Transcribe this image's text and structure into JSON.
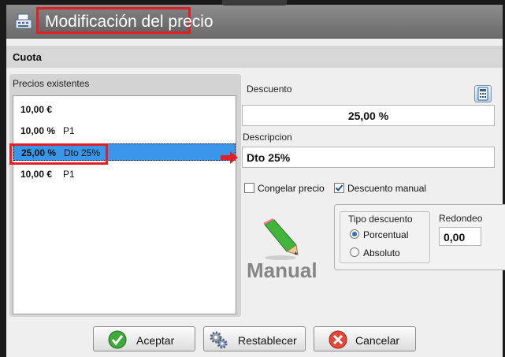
{
  "window": {
    "title": "Modificación del precio"
  },
  "section": {
    "title": "Cuota"
  },
  "prices": {
    "label": "Precios existentes",
    "items": [
      {
        "value": "10,00 €",
        "desc": ""
      },
      {
        "value": "10,00 %",
        "desc": "P1"
      },
      {
        "value": "25,00 %",
        "desc": "Dto 25%"
      },
      {
        "value": "10,00 €",
        "desc": "P1"
      }
    ]
  },
  "discount": {
    "label": "Descuento",
    "value": "25,00 %"
  },
  "description": {
    "label": "Descripcion",
    "value": "Dto 25%"
  },
  "options": {
    "freeze_price": "Congelar precio",
    "manual_discount": "Descuento manual"
  },
  "discount_type": {
    "title": "Tipo descuento",
    "percent": "Porcentual",
    "absolute": "Absoluto"
  },
  "rounding": {
    "label": "Redondeo",
    "value": "0,00"
  },
  "mode": {
    "label": "Manual"
  },
  "buttons": {
    "accept": "Aceptar",
    "reset": "Restablecer",
    "cancel": "Cancelar"
  },
  "colors": {
    "selection": "#3a96e8",
    "highlight": "#e01f26"
  }
}
